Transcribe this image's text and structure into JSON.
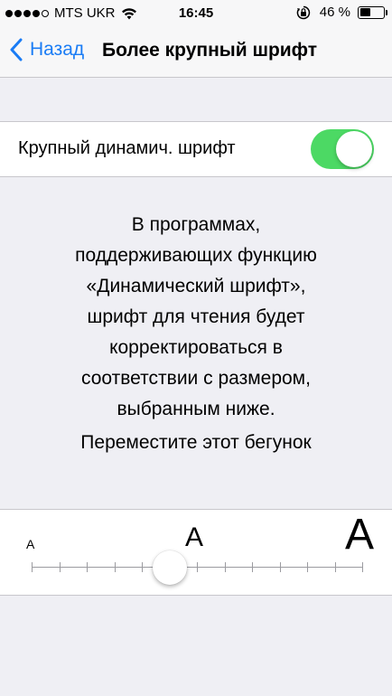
{
  "status_bar": {
    "carrier": "MTS UKR",
    "time": "16:45",
    "battery_percent": "46 %",
    "battery_level": 0.46,
    "signal_bars_filled": 4,
    "signal_bars_total": 5
  },
  "nav": {
    "back_label": "Назад",
    "title": "Более крупный шрифт"
  },
  "toggle_cell": {
    "label": "Крупный динамич. шрифт",
    "on": true,
    "on_color": "#4cd964"
  },
  "footer": {
    "description_lines": [
      "В программах,",
      "поддерживающих функцию",
      "«Динамический шрифт»,",
      "шрифт для чтения будет",
      "корректироваться в",
      "соответствии с размером,",
      "выбранным ниже."
    ],
    "hint": "Переместите этот бегунок"
  },
  "slider": {
    "small_label": "A",
    "mid_label": "A",
    "large_label": "A",
    "steps": 12,
    "value_step": 5
  },
  "colors": {
    "accent": "#1a7cf5",
    "background": "#efeff4"
  }
}
